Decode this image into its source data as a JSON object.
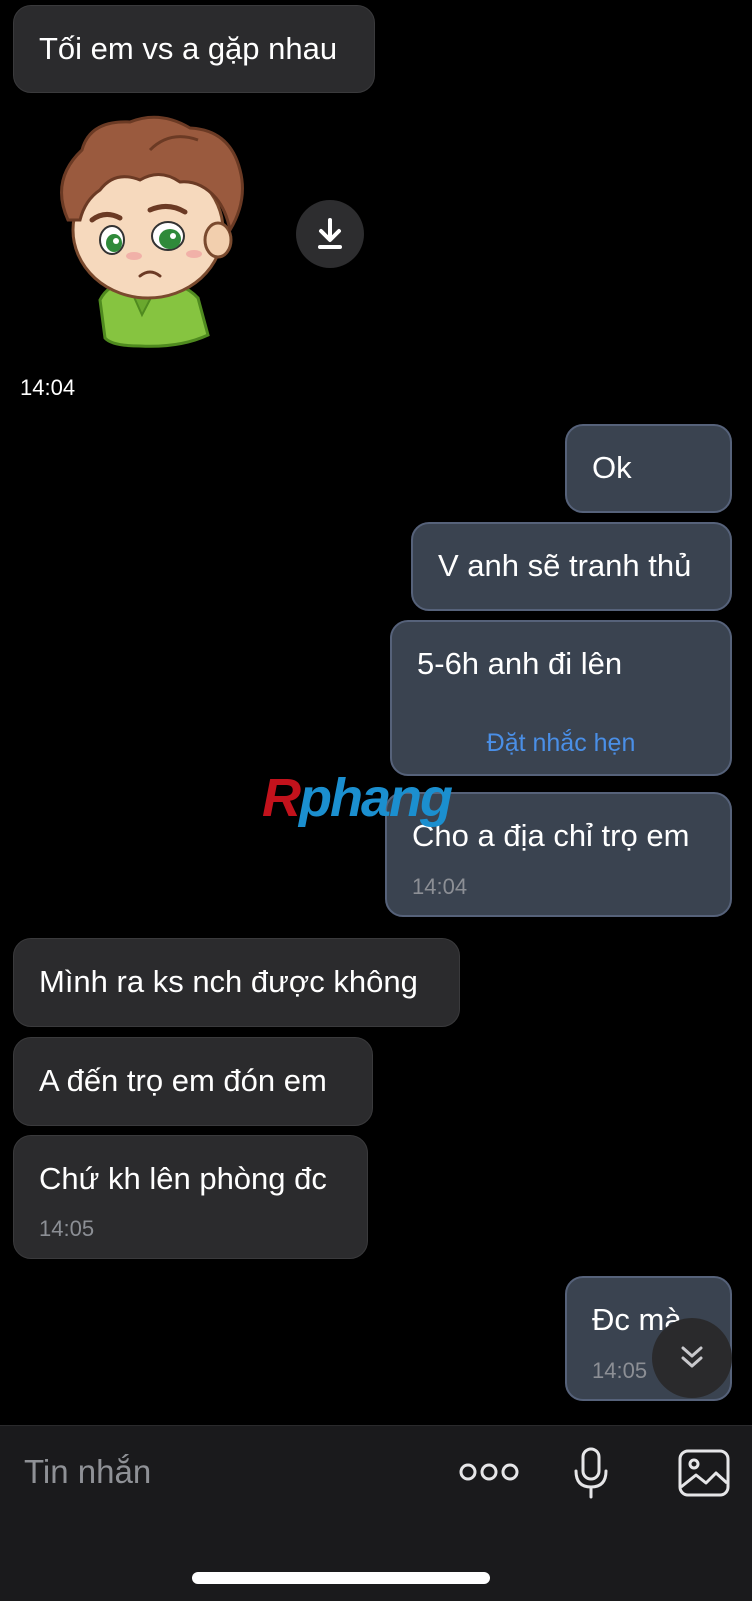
{
  "messages": {
    "m1": {
      "text": "Tối em vs a gặp nhau"
    },
    "sticker": {
      "time": "14:04",
      "icon": "download-icon"
    },
    "m2": {
      "text": "Ok"
    },
    "m3": {
      "text": "V anh sẽ tranh thủ"
    },
    "m4": {
      "text": "5-6h anh đi lên",
      "action": "Đặt nhắc hẹn"
    },
    "m5": {
      "text": "Cho a địa chỉ trọ em",
      "time": "14:04"
    },
    "m6": {
      "text": "Mình ra ks nch được không"
    },
    "m7": {
      "text": "A đến trọ em đón em"
    },
    "m8": {
      "text": "Chứ kh lên phòng đc",
      "time": "14:05"
    },
    "m9": {
      "text": "Đc mà",
      "time": "14:05"
    }
  },
  "watermark": {
    "part1": "R",
    "part2": "phang"
  },
  "scroll_button": {
    "icon": "double-chevron-down-icon"
  },
  "composer": {
    "placeholder": "Tin nhắn",
    "more_icon": "more-dots-icon",
    "mic_icon": "microphone-icon",
    "image_icon": "image-icon"
  },
  "colors": {
    "background": "#000000",
    "incoming_bubble": "#2b2b2d",
    "outgoing_bubble": "#3a4350",
    "link": "#4a8fe7",
    "timestamp": "#8c8f95"
  }
}
